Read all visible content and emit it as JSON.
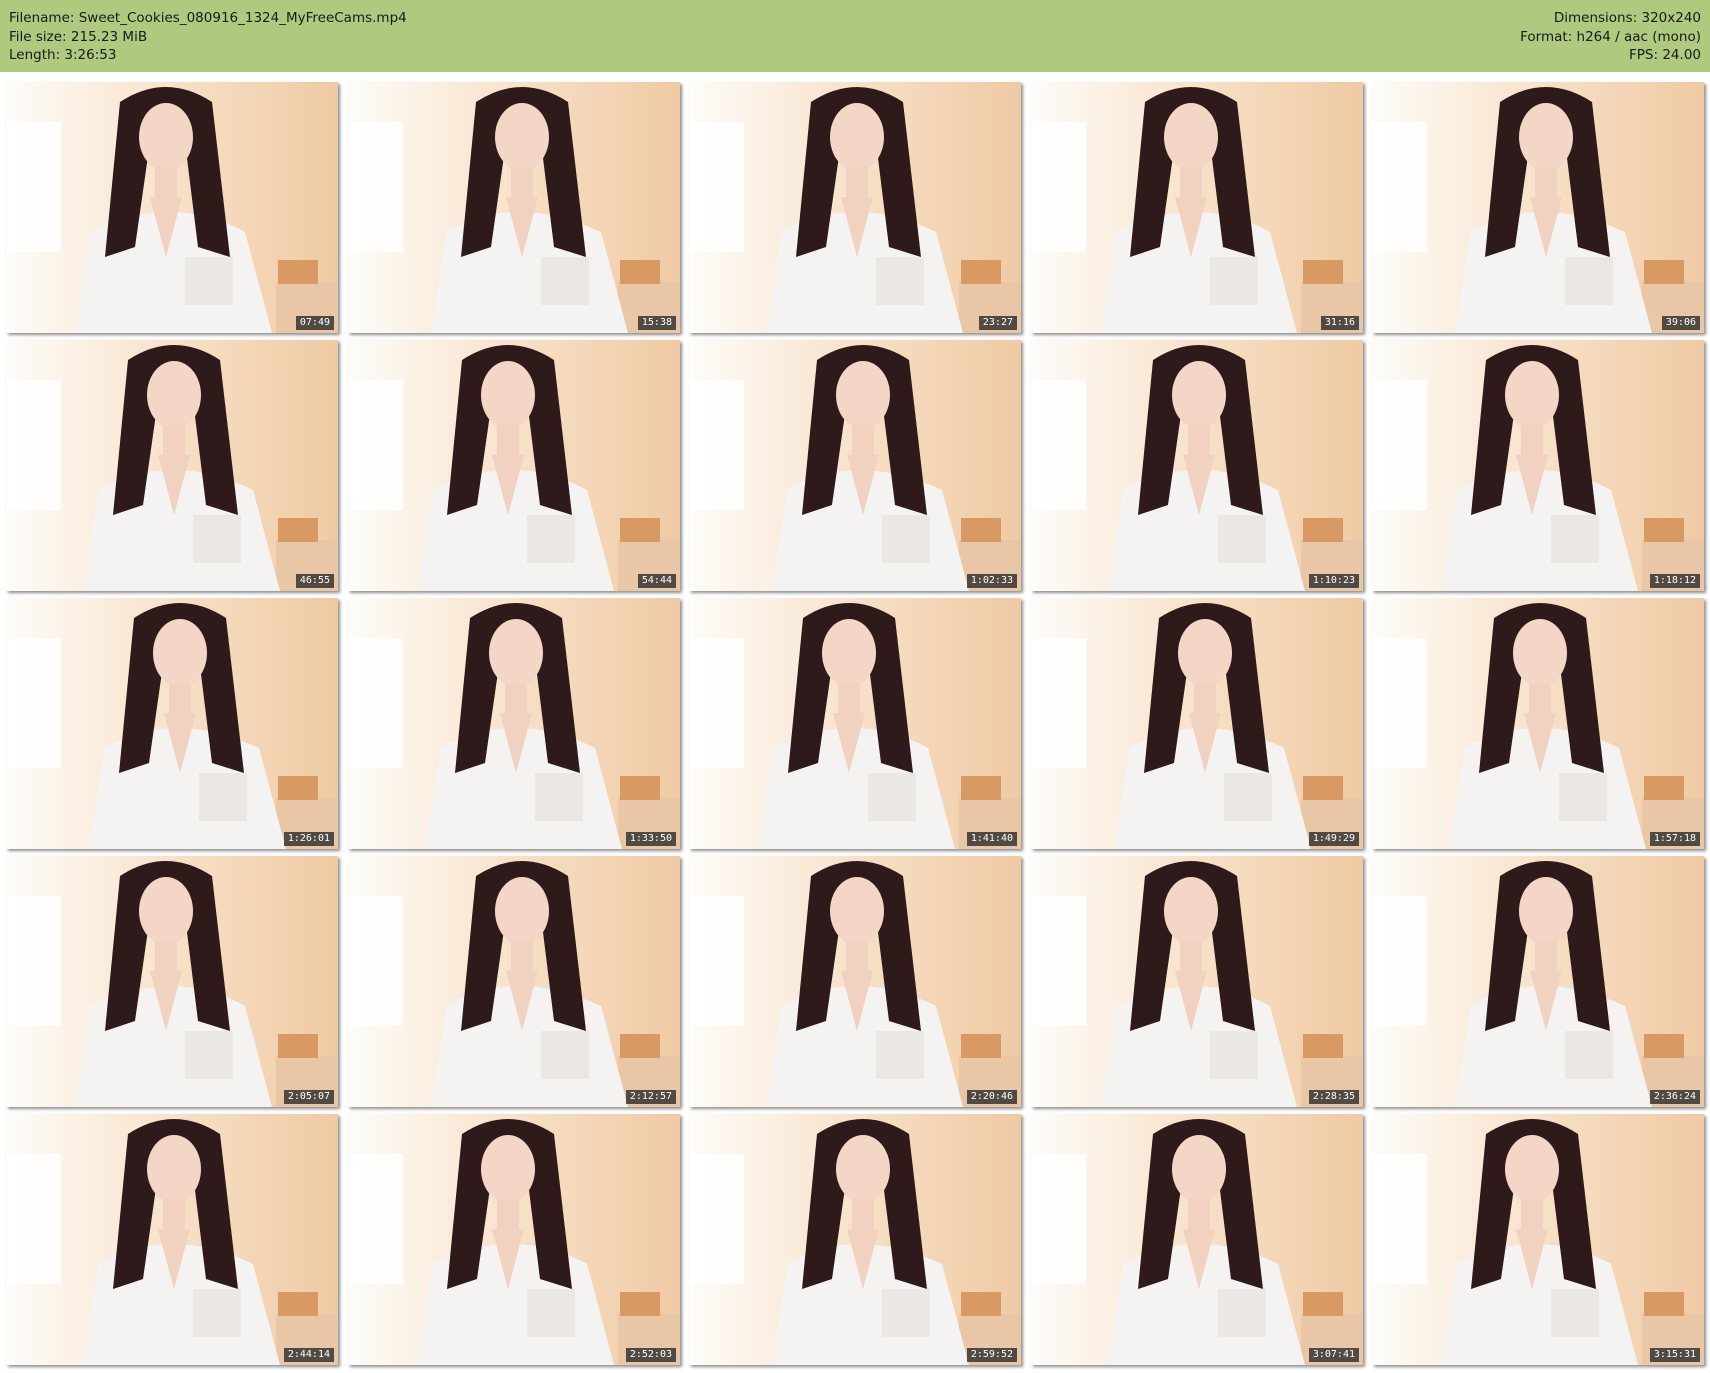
{
  "header": {
    "filename_line": "Filename: Sweet_Cookies_080916_1324_MyFreeCams.mp4",
    "filesize_line": "File size: 215.23 MiB",
    "length_line": "Length: 3:26:53",
    "dimensions_line": "Dimensions: 320x240",
    "format_line": "Format: h264 / aac (mono)",
    "fps_line": "FPS: 24.00"
  },
  "colors": {
    "header_bg": "#afc97e",
    "timestamp_bg": "#262626",
    "timestamp_text": "#ffffff"
  },
  "thumbnails": [
    {
      "timestamp": "07:49"
    },
    {
      "timestamp": "15:38"
    },
    {
      "timestamp": "23:27"
    },
    {
      "timestamp": "31:16"
    },
    {
      "timestamp": "39:06"
    },
    {
      "timestamp": "46:55"
    },
    {
      "timestamp": "54:44"
    },
    {
      "timestamp": "1:02:33"
    },
    {
      "timestamp": "1:10:23"
    },
    {
      "timestamp": "1:18:12"
    },
    {
      "timestamp": "1:26:01"
    },
    {
      "timestamp": "1:33:50"
    },
    {
      "timestamp": "1:41:40"
    },
    {
      "timestamp": "1:49:29"
    },
    {
      "timestamp": "1:57:18"
    },
    {
      "timestamp": "2:05:07"
    },
    {
      "timestamp": "2:12:57"
    },
    {
      "timestamp": "2:20:46"
    },
    {
      "timestamp": "2:28:35"
    },
    {
      "timestamp": "2:36:24"
    },
    {
      "timestamp": "2:44:14"
    },
    {
      "timestamp": "2:52:03"
    },
    {
      "timestamp": "2:59:52"
    },
    {
      "timestamp": "3:07:41"
    },
    {
      "timestamp": "3:15:31"
    }
  ]
}
